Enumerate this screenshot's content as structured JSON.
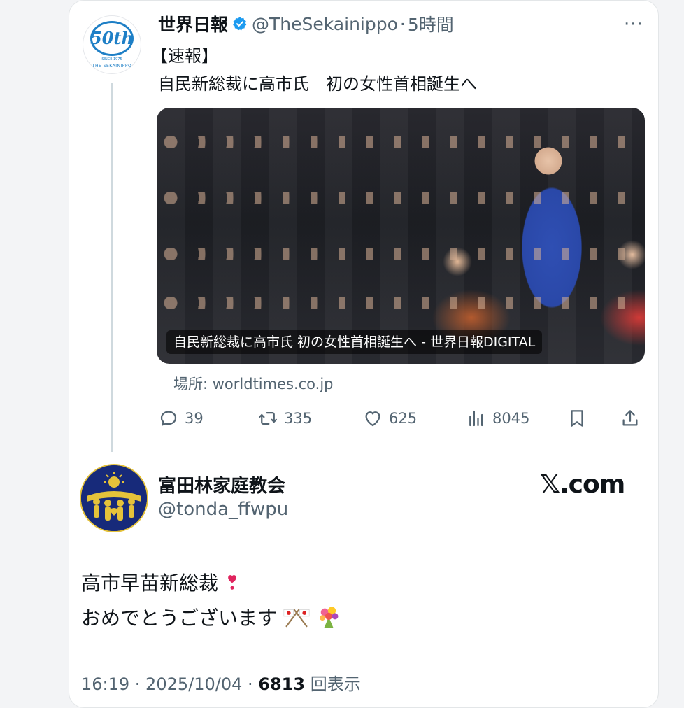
{
  "quoted": {
    "name": "世界日報",
    "handle": "@TheSekainippo",
    "dot": "·",
    "time": "5時間",
    "more": "···",
    "line1": "【速報】",
    "line2": "自民新総裁に高市氏　初の女性首相誕生へ",
    "avatar": {
      "logo": "50th",
      "since": "SINCE 1975",
      "brand": "THE SEKAINIPPO"
    },
    "media_caption": "自民新総裁に高市氏 初の女性首相誕生へ - 世界日報DIGITAL",
    "source": "場所: worldtimes.co.jp",
    "actions": {
      "replies": "39",
      "reposts": "335",
      "likes": "625",
      "views": "8045"
    }
  },
  "main": {
    "name": "富田林家庭教会",
    "handle": "@tonda_ffwpu",
    "site": "𝕏.com",
    "text_line1": "高市早苗新総裁",
    "text_line2": "おめでとうございます",
    "meta_time": "16:19 · 2025/10/04 · ",
    "meta_views": "6813",
    "meta_views_label": " 回表示"
  },
  "colors": {
    "accent": "#1d9bf0",
    "muted": "#536471",
    "text": "#0f1419",
    "avatar_blue": "#172a7a",
    "avatar_gold": "#e5c23a"
  }
}
